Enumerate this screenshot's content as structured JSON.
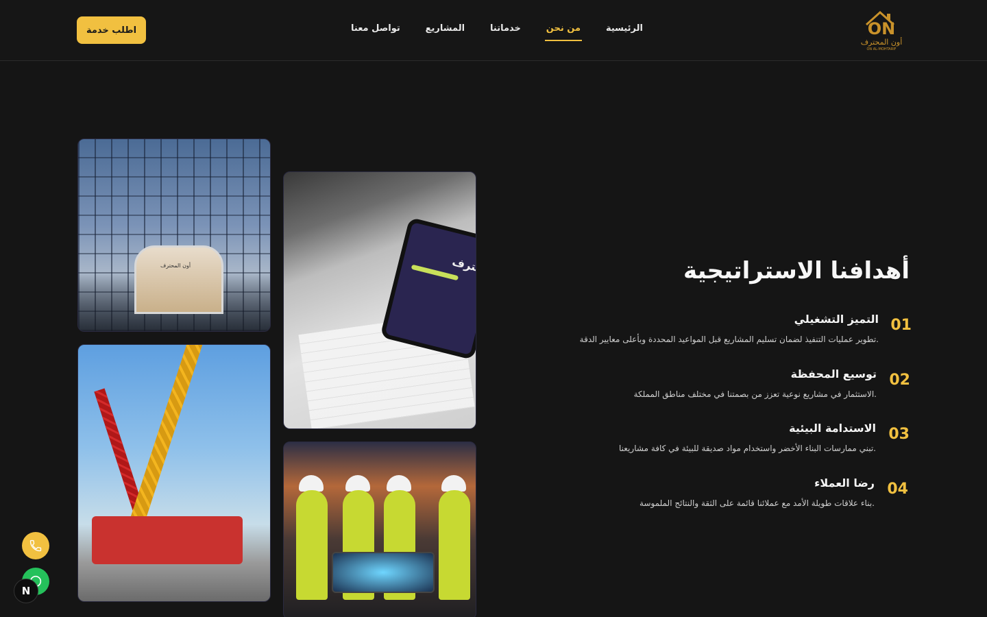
{
  "header": {
    "cta_label": "اطلب خدمة",
    "nav": [
      {
        "label": "الرئيسية",
        "active": false
      },
      {
        "label": "من نحن",
        "active": true
      },
      {
        "label": "خدماتنا",
        "active": false
      },
      {
        "label": "المشاريع",
        "active": false
      },
      {
        "label": "تواصل معنا",
        "active": false
      }
    ],
    "logo": {
      "mark": "ON",
      "name": "أون المحترف",
      "subtitle": "ON AL-MOHTARIF"
    }
  },
  "images": {
    "building_sign": "أون المحترف",
    "tablet_text": "حترف"
  },
  "section": {
    "title": "أهدافنا الاستراتيجية",
    "goals": [
      {
        "number": "01",
        "title": "التميز التشغيلي",
        "description": "تطوير عمليات التنفيذ لضمان تسليم المشاريع قبل المواعيد المحددة وبأعلى معايير الدقة."
      },
      {
        "number": "02",
        "title": "توسيع المحفظة",
        "description": "الاستثمار في مشاريع نوعية تعزز من بصمتنا في مختلف مناطق المملكة."
      },
      {
        "number": "03",
        "title": "الاستدامة البيئية",
        "description": "تبني ممارسات البناء الأخضر واستخدام مواد صديقة للبيئة في كافة مشاريعنا."
      },
      {
        "number": "04",
        "title": "رضا العملاء",
        "description": "بناء علاقات طويلة الأمد مع عملائنا قائمة على الثقة والنتائج الملموسة."
      }
    ]
  },
  "floating": {
    "n_badge": "N"
  },
  "colors": {
    "accent": "#f1c040",
    "background": "#151515",
    "whatsapp": "#25c15b"
  }
}
